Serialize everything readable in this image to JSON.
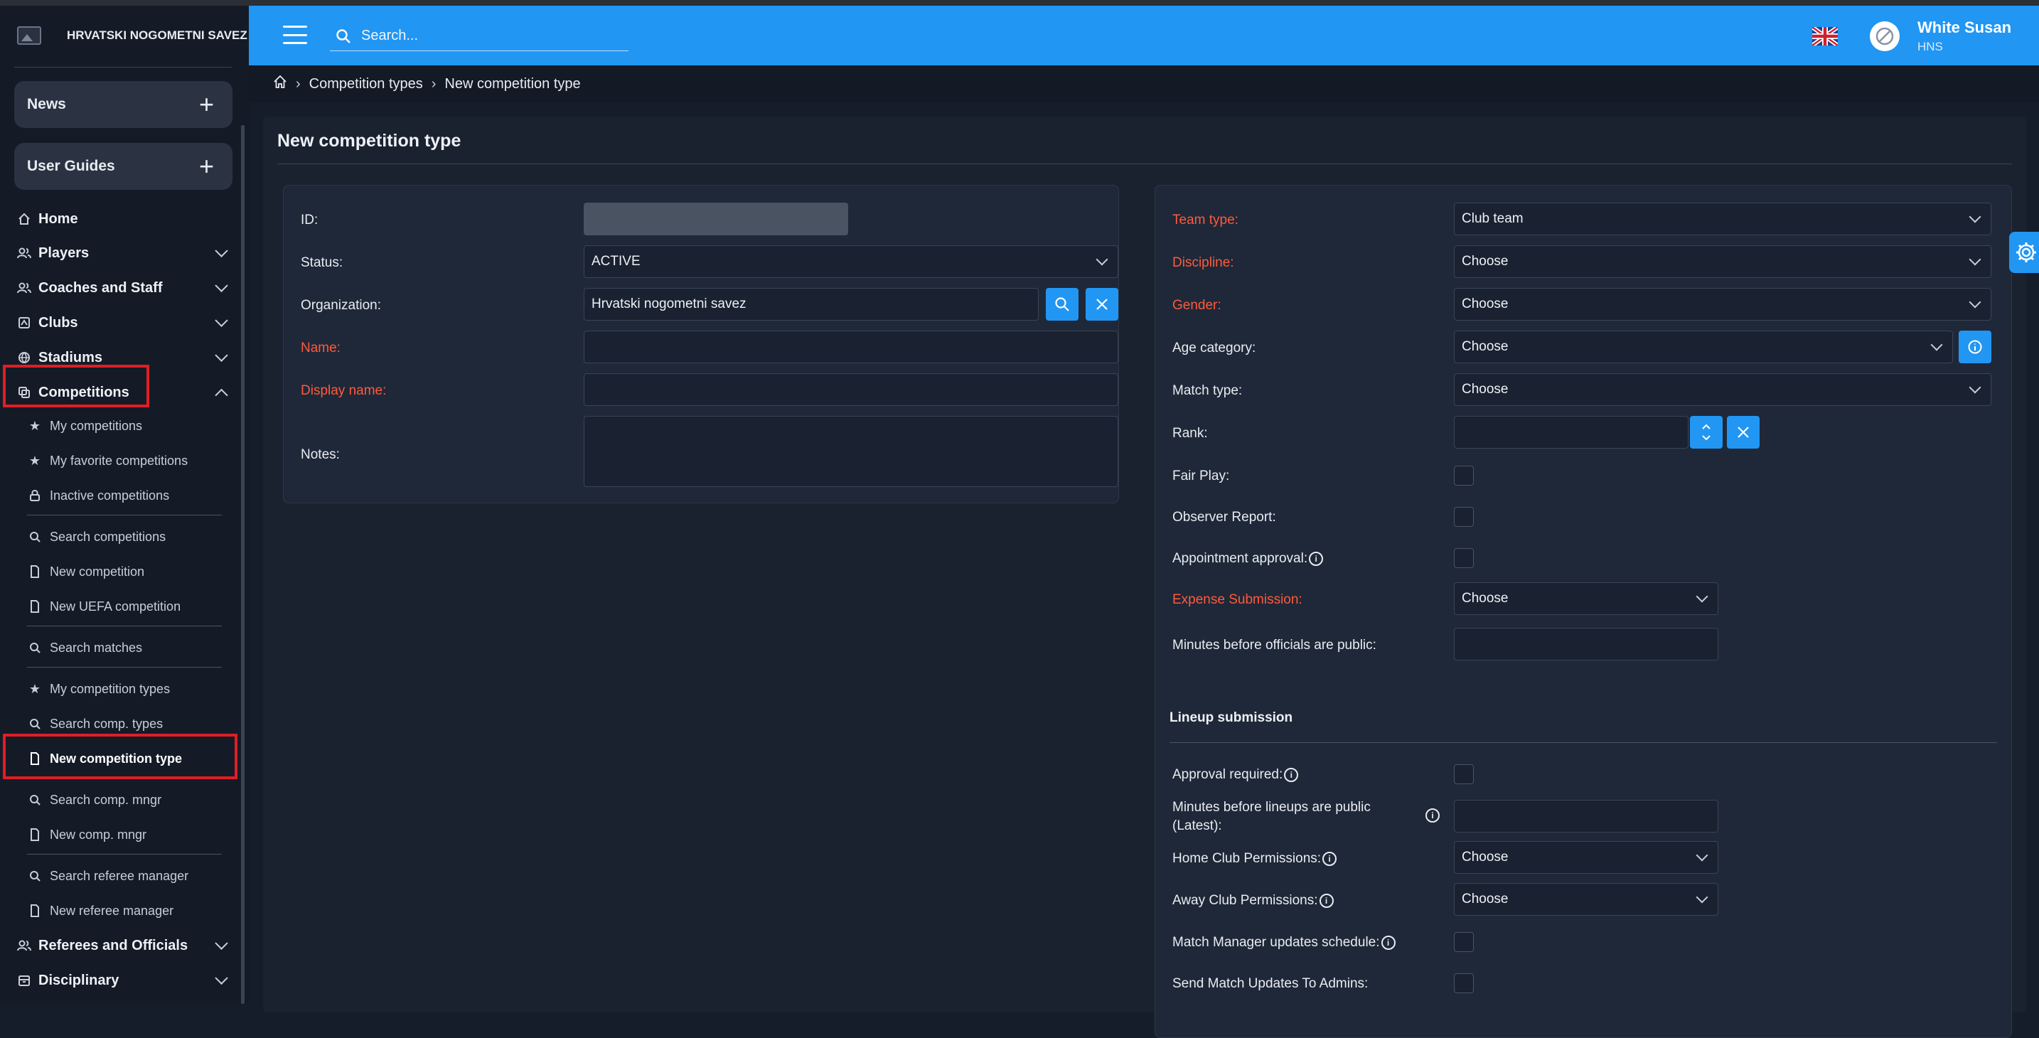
{
  "brand": {
    "name": "HRVATSKI NOGOMETNI SAVEZ"
  },
  "sidebar": {
    "cards": [
      {
        "label": "News"
      },
      {
        "label": "User Guides"
      }
    ],
    "nav": {
      "home": "Home",
      "players": "Players",
      "coaches": "Coaches and Staff",
      "clubs": "Clubs",
      "stadiums": "Stadiums",
      "competitions": "Competitions",
      "referees": "Referees and Officials",
      "disciplinary": "Disciplinary"
    },
    "sub": {
      "my_competitions": "My competitions",
      "my_favorite": "My favorite competitions",
      "inactive": "Inactive competitions",
      "search_competitions": "Search competitions",
      "new_competition": "New competition",
      "new_uefa": "New UEFA competition",
      "search_matches": "Search matches",
      "my_comp_types": "My competition types",
      "search_comp_types": "Search comp. types",
      "new_comp_type": "New competition type",
      "search_comp_mngr": "Search comp. mngr",
      "new_comp_mngr": "New comp. mngr",
      "search_referee_mgr": "Search referee manager",
      "new_referee_mgr": "New referee manager"
    }
  },
  "header": {
    "search_placeholder": "Search...",
    "user_name": "White Susan",
    "user_org": "HNS"
  },
  "breadcrumb": {
    "items": [
      "Competition types",
      "New competition type"
    ]
  },
  "page": {
    "title": "New competition type"
  },
  "left_form": {
    "id_label": "ID:",
    "status_label": "Status:",
    "status_value": "ACTIVE",
    "org_label": "Organization:",
    "org_value": "Hrvatski nogometni savez",
    "name_label": "Name:",
    "display_name_label": "Display name:",
    "notes_label": "Notes:"
  },
  "right_form": {
    "team_type_label": "Team type:",
    "team_type_value": "Club team",
    "discipline_label": "Discipline:",
    "discipline_value": "Choose",
    "gender_label": "Gender:",
    "gender_value": "Choose",
    "age_label": "Age category:",
    "age_value": "Choose",
    "match_type_label": "Match type:",
    "match_type_value": "Choose",
    "rank_label": "Rank:",
    "fair_play_label": "Fair Play:",
    "observer_label": "Observer Report:",
    "appointment_label": "Appointment approval:",
    "expense_label": "Expense Submission:",
    "expense_value": "Choose",
    "minutes_officials_label": "Minutes before officials are public:",
    "lineup_section": "Lineup submission",
    "approval_label": "Approval required:",
    "minutes_lineups_label_1": "Minutes before lineups are public",
    "minutes_lineups_label_2": "(Latest):",
    "home_perm_label": "Home Club Permissions:",
    "home_perm_value": "Choose",
    "away_perm_label": "Away Club Permissions:",
    "away_perm_value": "Choose",
    "mm_updates_label": "Match Manager updates schedule:",
    "send_updates_label": "Send Match Updates To Admins:"
  }
}
